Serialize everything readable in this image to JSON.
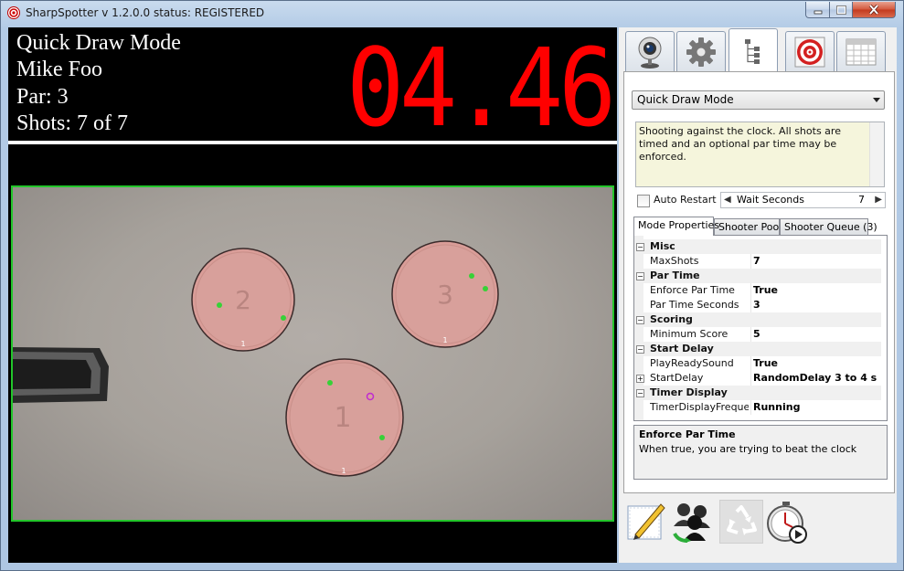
{
  "window": {
    "title": "SharpSpotter v 1.2.0.0 status: REGISTERED"
  },
  "scoreboard": {
    "mode": "Quick Draw Mode",
    "shooter": "Mike Foo",
    "par": "Par: 3",
    "shots": "Shots: 7 of 7",
    "timer": "04.46",
    "timer_color": "#ff0000"
  },
  "camera_view": {
    "border_color": "#22c52a",
    "targets": [
      {
        "number": "2",
        "bottom_label": "1"
      },
      {
        "number": "3",
        "bottom_label": "1"
      },
      {
        "number": "1",
        "bottom_label": "1"
      }
    ]
  },
  "tabs": [
    {
      "icon": "webcam-icon"
    },
    {
      "icon": "gear-icon"
    },
    {
      "icon": "tree-icon",
      "active": true
    },
    {
      "icon": "target-icon"
    },
    {
      "icon": "calendar-grid-icon"
    }
  ],
  "mode_panel": {
    "selected_mode": "Quick Draw Mode",
    "description": "Shooting against the clock. All shots are timed and an optional par time may be enforced.",
    "auto_restart_label": "Auto Restart",
    "auto_restart_checked": false,
    "wait_label": "Wait Seconds",
    "wait_value": "7"
  },
  "subtabs": [
    {
      "label": "Mode Properties",
      "active": true
    },
    {
      "label": "Shooter Pool"
    },
    {
      "label": "Shooter Queue (3)"
    }
  ],
  "properties": {
    "misc": {
      "label": "Misc",
      "max_shots_name": "MaxShots",
      "max_shots_value": "7"
    },
    "par_time": {
      "label": "Par Time",
      "enforce_name": "Enforce Par Time",
      "enforce_value": "True",
      "seconds_name": "Par Time Seconds",
      "seconds_value": "3"
    },
    "scoring": {
      "label": "Scoring",
      "min_score_name": "Minimum Score",
      "min_score_value": "5"
    },
    "start_delay": {
      "label": "Start Delay",
      "sound_name": "PlayReadySound",
      "sound_value": "True",
      "delay_name": "StartDelay",
      "delay_value": "RandomDelay 3 to 4 s"
    },
    "timer_display": {
      "label": "Timer Display",
      "freq_name": "TimerDisplayFrequency",
      "freq_value": "Running"
    }
  },
  "help": {
    "title": "Enforce Par Time",
    "description": "When true, you are trying to beat the clock"
  },
  "toolbar": [
    {
      "icon": "edit-pencil-icon"
    },
    {
      "icon": "shooter-group-icon"
    },
    {
      "icon": "recycle-icon",
      "disabled": true
    },
    {
      "icon": "stopwatch-play-icon"
    }
  ]
}
